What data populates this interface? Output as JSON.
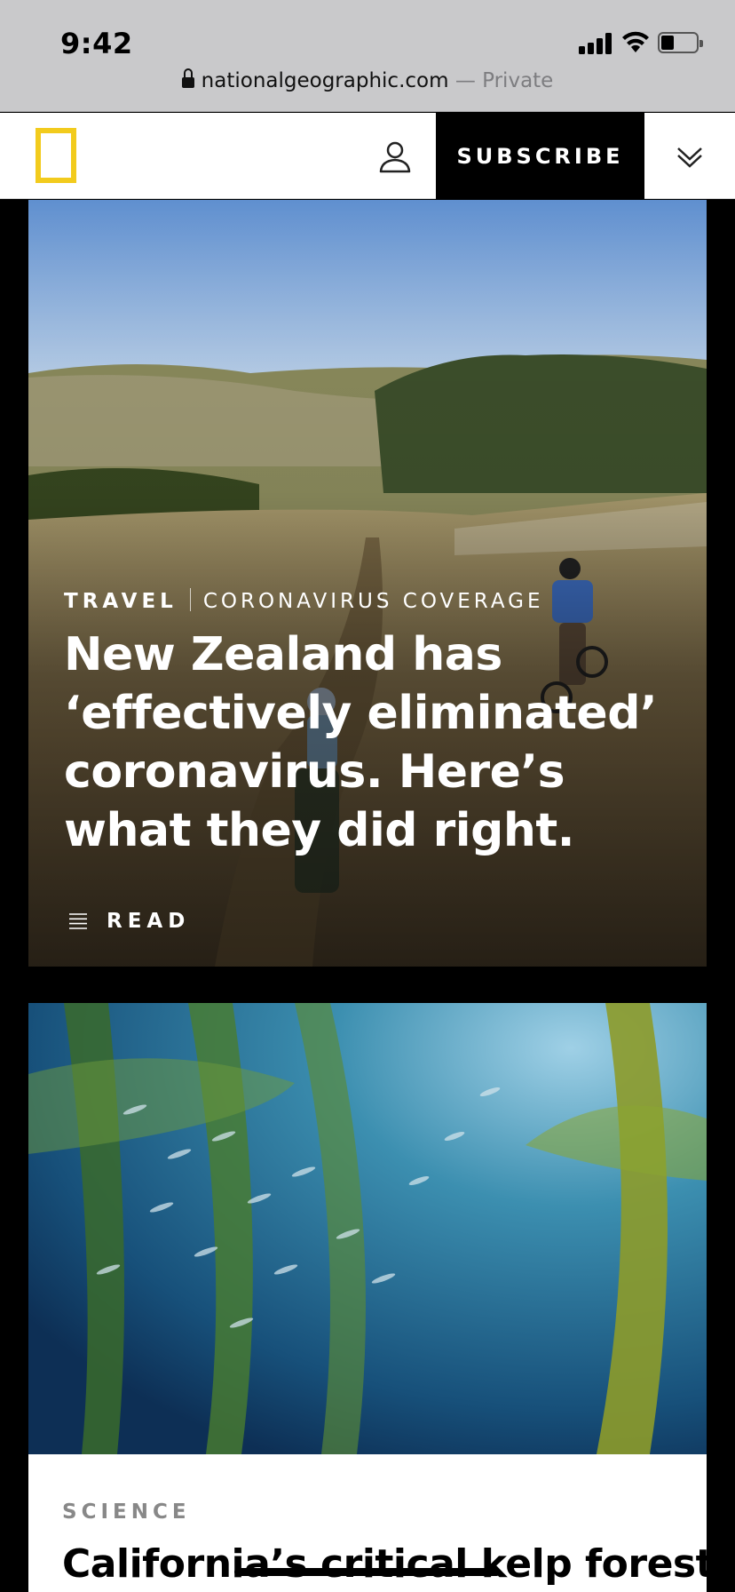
{
  "status_bar": {
    "time": "9:42"
  },
  "url_bar": {
    "domain": "nationalgeographic.com",
    "separator": " — ",
    "mode": "Private"
  },
  "header": {
    "logo_icon": "natgeo-yellow-border-logo",
    "account_icon": "user-icon",
    "subscribe_label": "SUBSCRIBE",
    "menu_icon": "chevron-down-double-icon",
    "brand_color": "#f2cb1d"
  },
  "cards": [
    {
      "category": "TRAVEL",
      "subcategory": "CORONAVIRUS COVERAGE",
      "headline": "New Zealand has ‘effectively eliminated’ coronavirus. Here’s what they did right.",
      "action_label": "READ",
      "action_icon": "article-lines-icon",
      "image": "mountain-bikers-on-grassy-hills"
    },
    {
      "category": "SCIENCE",
      "headline": "California’s critical kelp forests",
      "image": "kelp-forest-with-fish-school"
    }
  ]
}
